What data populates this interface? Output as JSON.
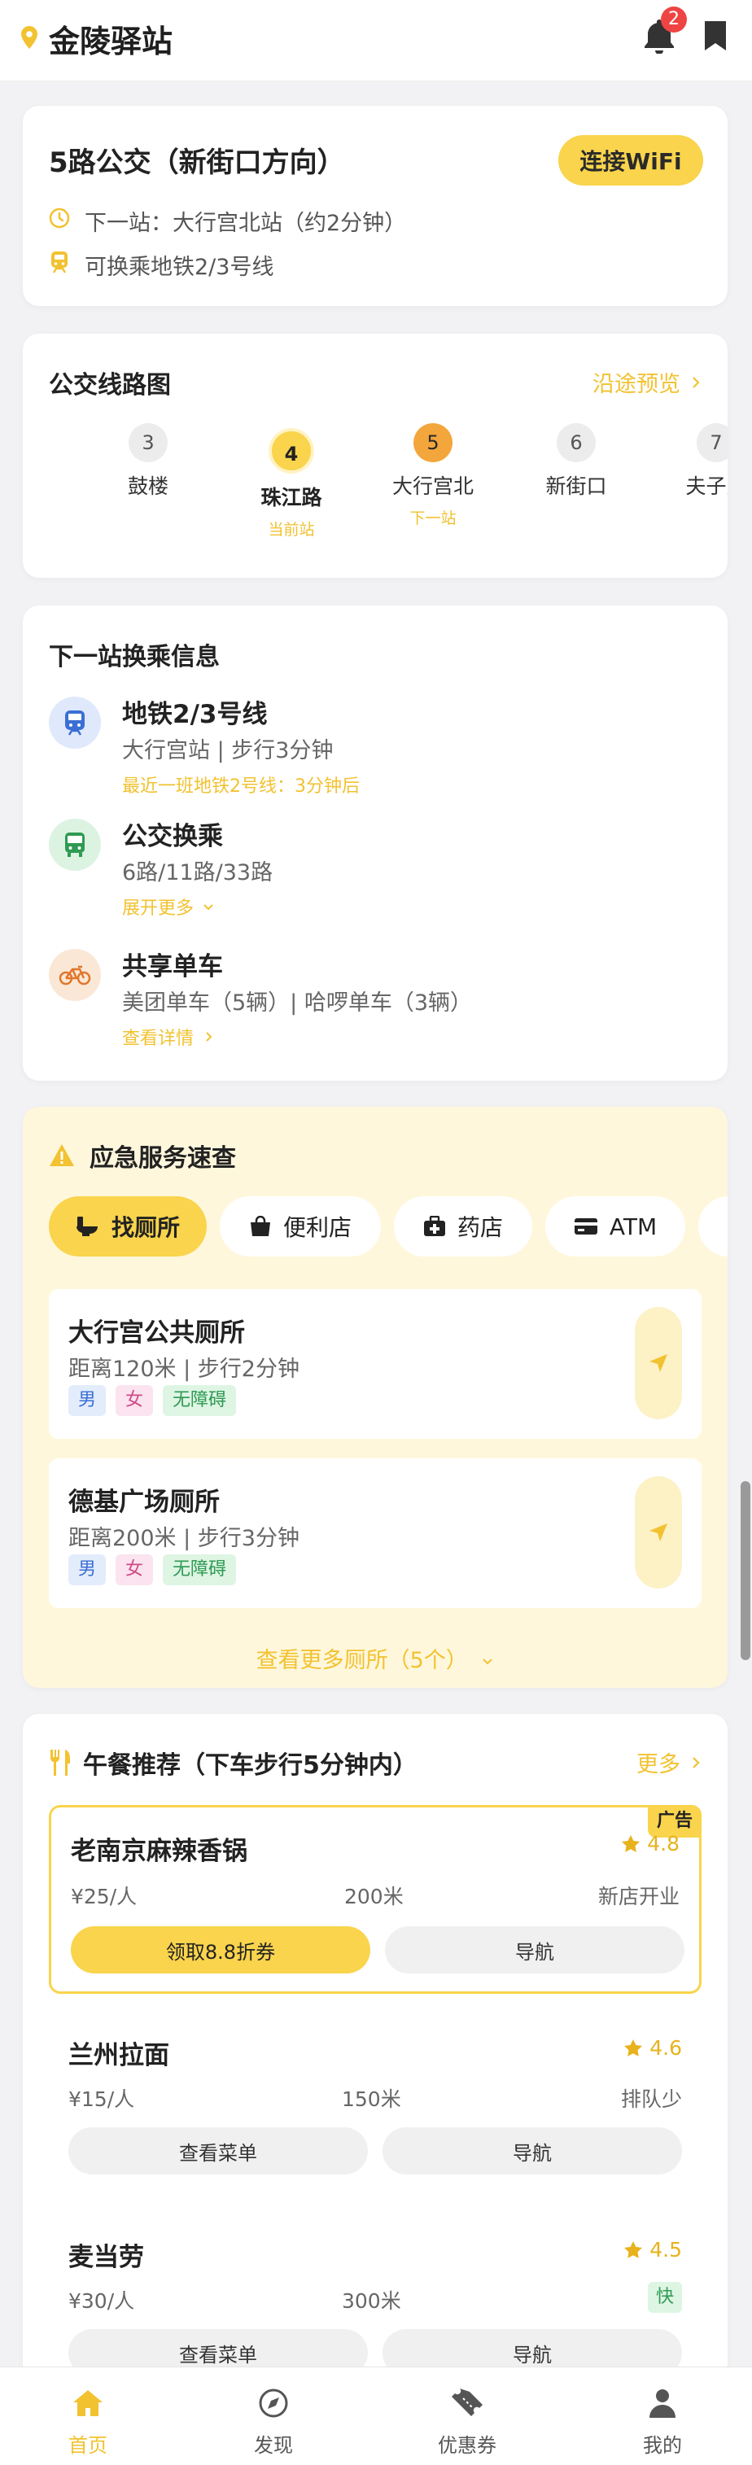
{
  "header": {
    "title": "金陵驿站",
    "notification_count": "2"
  },
  "route": {
    "title": "5路公交（新街口方向）",
    "wifi_button": "连接WiFi",
    "next_stop": "下一站：大行宫北站（约2分钟）",
    "transfer_hint": "可换乘地铁2/3号线"
  },
  "line_map": {
    "title": "公交线路图",
    "preview_link": "沿途预览",
    "stations": [
      {
        "num": "3",
        "name": "鼓楼",
        "sub": ""
      },
      {
        "num": "4",
        "name": "珠江路",
        "sub": "当前站"
      },
      {
        "num": "5",
        "name": "大行宫北",
        "sub": "下一站"
      },
      {
        "num": "6",
        "name": "新街口",
        "sub": ""
      },
      {
        "num": "7",
        "name": "夫子庙",
        "sub": ""
      }
    ]
  },
  "transfer": {
    "title": "下一站换乘信息",
    "items": [
      {
        "title": "地铁2/3号线",
        "desc": "大行宫站 | 步行3分钟",
        "note": "最近一班地铁2号线：3分钟后"
      },
      {
        "title": "公交换乘",
        "desc": "6路/11路/33路",
        "note": "展开更多"
      },
      {
        "title": "共享单车",
        "desc": "美团单车（5辆）| 哈啰单车（3辆）",
        "note": "查看详情"
      }
    ]
  },
  "emergency": {
    "title": "应急服务速查",
    "chips": [
      "找厕所",
      "便利店",
      "药店",
      "ATM"
    ],
    "toilets": [
      {
        "name": "大行宫公共厕所",
        "dist": "距离120米 | 步行2分钟",
        "tags": [
          "男",
          "女",
          "无障碍"
        ]
      },
      {
        "name": "德基广场厕所",
        "dist": "距离200米 | 步行3分钟",
        "tags": [
          "男",
          "女",
          "无障碍"
        ]
      }
    ],
    "more": "查看更多厕所（5个）"
  },
  "lunch": {
    "title": "午餐推荐（下车步行5分钟内）",
    "more": "更多",
    "ad_label": "广告",
    "restaurants": [
      {
        "name": "老南京麻辣香锅",
        "rating": "4.8",
        "price": "¥25/人",
        "distance": "200米",
        "extra": "新店开业",
        "btn1": "领取8.8折券",
        "btn2": "导航"
      },
      {
        "name": "兰州拉面",
        "rating": "4.6",
        "price": "¥15/人",
        "distance": "150米",
        "extra": "排队少",
        "btn1": "查看菜单",
        "btn2": "导航"
      },
      {
        "name": "麦当劳",
        "rating": "4.5",
        "price": "¥30/人",
        "distance": "300米",
        "extra": "快",
        "btn1": "查看菜单",
        "btn2": "导航"
      }
    ]
  },
  "bottom_nav": [
    "首页",
    "发现",
    "优惠券",
    "我的"
  ],
  "colors": {
    "accent": "#f9d44c",
    "accent_text": "#f2c230",
    "emergency_bg": "#fff7dc"
  }
}
